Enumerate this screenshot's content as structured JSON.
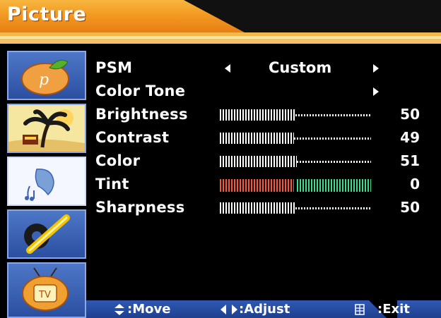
{
  "menu": {
    "title": "Picture",
    "rows": [
      {
        "label": "PSM",
        "type": "select",
        "value": "Custom"
      },
      {
        "label": "Color Tone",
        "type": "submenu"
      },
      {
        "label": "Brightness",
        "type": "slider",
        "value": "50",
        "level": 0.5
      },
      {
        "label": "Contrast",
        "type": "slider",
        "value": "49",
        "level": 0.49
      },
      {
        "label": "Color",
        "type": "slider",
        "value": "51",
        "level": 0.51
      },
      {
        "label": "Tint",
        "type": "tint",
        "value": "0",
        "level": 0.5
      },
      {
        "label": "Sharpness",
        "type": "slider",
        "value": "50",
        "level": 0.5
      }
    ]
  },
  "sidebar": {
    "items": [
      {
        "name": "picture",
        "icon": "picture-icon",
        "letter": "p"
      },
      {
        "name": "sound-palm",
        "icon": "palm-island-icon"
      },
      {
        "name": "sound",
        "icon": "dolphin-music-icon",
        "active": true
      },
      {
        "name": "setup",
        "icon": "tools-icon"
      },
      {
        "name": "input",
        "icon": "tv-icon",
        "letter": "TV"
      }
    ]
  },
  "footer": {
    "move": ":Move",
    "adjust": ":Adjust",
    "exit": ":Exit"
  },
  "colors": {
    "header_orange": "#f39a22",
    "sidebar_blue": "#3b62b8",
    "tint_red": "#ff5430",
    "tint_green": "#2fe08e"
  }
}
